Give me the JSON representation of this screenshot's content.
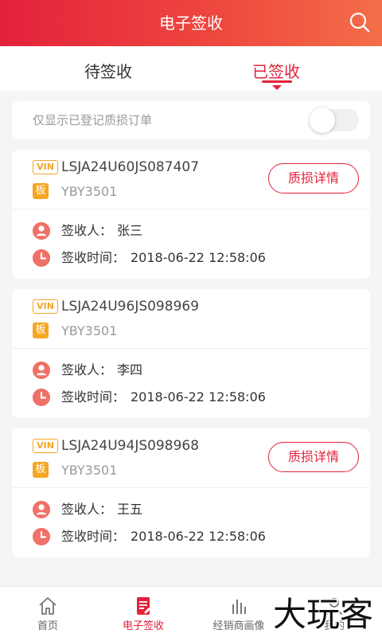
{
  "header": {
    "title": "电子签收",
    "search_icon": "search-icon"
  },
  "tabs": [
    {
      "label": "待签收",
      "active": false
    },
    {
      "label": "已签收",
      "active": true
    }
  ],
  "filter": {
    "label": "仅显示已登记质损订单",
    "toggle_on": false
  },
  "cards": [
    {
      "vin_badge": "VIN",
      "vin": "LSJA24U60JS087407",
      "plate_badge": "板",
      "plate": "YBY3501",
      "detail_button": "质损详情",
      "signer_label": "签收人：",
      "signer": "张三",
      "time_label": "签收时间：",
      "time": "2018-06-22 12:58:06"
    },
    {
      "vin_badge": "VIN",
      "vin": "LSJA24U96JS098969",
      "plate_badge": "板",
      "plate": "YBY3501",
      "signer_label": "签收人：",
      "signer": "李四",
      "time_label": "签收时间：",
      "time": "2018-06-22 12:58:06"
    },
    {
      "vin_badge": "VIN",
      "vin": "LSJA24U94JS098968",
      "plate_badge": "板",
      "plate": "YBY3501",
      "detail_button": "质损详情",
      "signer_label": "签收人：",
      "signer": "王五",
      "time_label": "签收时间：",
      "time": "2018-06-22 12:58:06"
    }
  ],
  "bottom_nav": [
    {
      "label": "首页",
      "icon": "home-icon",
      "active": false
    },
    {
      "label": "电子签收",
      "icon": "document-icon",
      "active": true
    },
    {
      "label": "经销商画像",
      "icon": "bar-chart-icon",
      "active": false
    },
    {
      "label": "我的",
      "icon": "user-icon",
      "active": false
    }
  ],
  "watermark": {
    "text": "大玩客"
  },
  "colors": {
    "accent": "#e3223b",
    "badge": "#f5a623",
    "icon": "#f07167"
  }
}
